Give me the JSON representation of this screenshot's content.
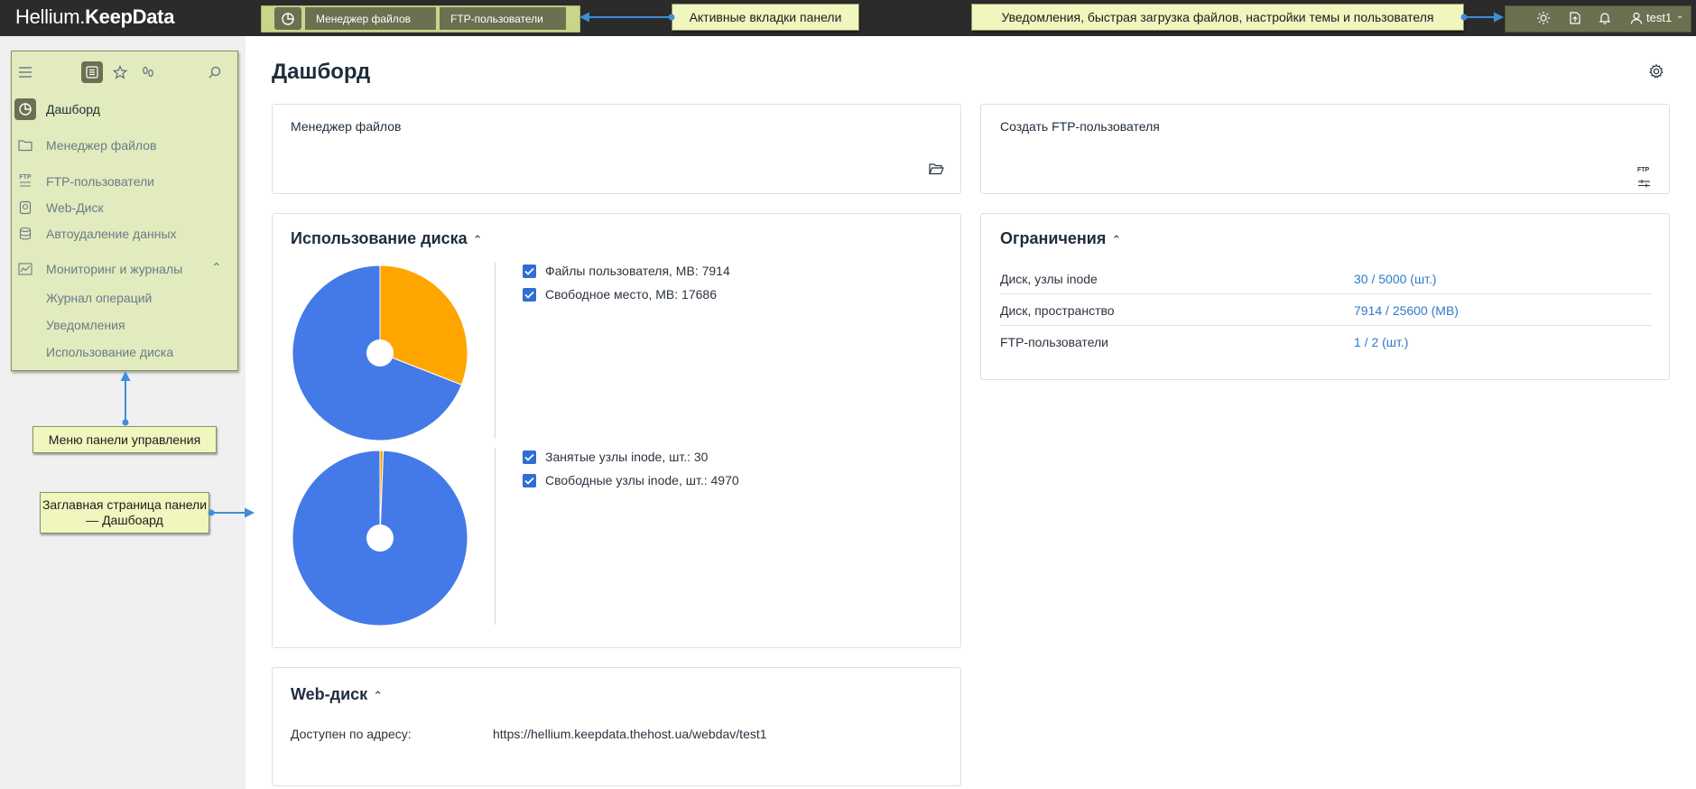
{
  "header": {
    "brand_left": "Hellium.",
    "brand_right": "KeepData",
    "tabs": [
      {
        "label": "Менеджер файлов"
      },
      {
        "label": "FTP-пользователи"
      }
    ],
    "user": "test1"
  },
  "callouts": {
    "tabs": "Активные вкладки панели",
    "right": "Уведомления, быстрая загрузка файлов, настройки темы и пользователя",
    "menu": "Меню панели управления",
    "home": "Заглавная страница панели — Дашбоард"
  },
  "sidebar": {
    "items": [
      {
        "label": "Дашборд",
        "icon": "dashboard-icon"
      },
      {
        "label": "Менеджер файлов",
        "icon": "folder-icon"
      },
      {
        "label": "FTP-пользователи",
        "icon": "ftp-icon"
      },
      {
        "label": "Web-Диск",
        "icon": "web-disk-icon"
      },
      {
        "label": "Автоудаление данных",
        "icon": "auto-delete-icon"
      },
      {
        "label": "Мониторинг и журналы",
        "icon": "monitoring-icon"
      }
    ],
    "sub_items": [
      {
        "label": "Журнал операций"
      },
      {
        "label": "Уведомления"
      },
      {
        "label": "Использование диска"
      }
    ],
    "ftp_tag": "FTP"
  },
  "main": {
    "title": "Дашборд",
    "quick_cards": [
      {
        "title": "Менеджер файлов",
        "icon": "folder-open-icon"
      },
      {
        "title": "Создать FTP-пользователя",
        "icon": "ftp-settings-icon"
      }
    ],
    "disk_usage": {
      "title": "Использование диска",
      "space_legend": [
        {
          "label": "Файлы пользователя, MB: 7914",
          "color": "#ffa500"
        },
        {
          "label": "Свободное место, MB: 17686",
          "color": "#4479e8"
        }
      ],
      "inode_legend": [
        {
          "label": "Занятые узлы inode, шт.: 30",
          "color": "#ffa500"
        },
        {
          "label": "Свободные узлы inode, шт.: 4970",
          "color": "#4479e8"
        }
      ]
    },
    "limits": {
      "title": "Ограничения",
      "rows": [
        {
          "label": "Диск, узлы inode",
          "value": "30 / 5000 (шт.)"
        },
        {
          "label": "Диск, пространство",
          "value": "7914 / 25600 (MB)"
        },
        {
          "label": "FTP-пользователи",
          "value": "1 / 2 (шт.)"
        }
      ]
    },
    "web_disk": {
      "title": "Web-диск",
      "label": "Доступен по адресу:",
      "url": "https://hellium.keepdata.thehost.ua/webdav/test1"
    }
  },
  "chart_data": [
    {
      "type": "pie",
      "categories": [
        "Файлы пользователя, MB",
        "Свободное место, MB"
      ],
      "values": [
        7914,
        17686
      ],
      "colors": [
        "#ffa500",
        "#4479e8"
      ]
    },
    {
      "type": "pie",
      "categories": [
        "Занятые узлы inode, шт.",
        "Свободные узлы inode, шт."
      ],
      "values": [
        30,
        4970
      ],
      "colors": [
        "#ffa500",
        "#4479e8"
      ]
    }
  ]
}
